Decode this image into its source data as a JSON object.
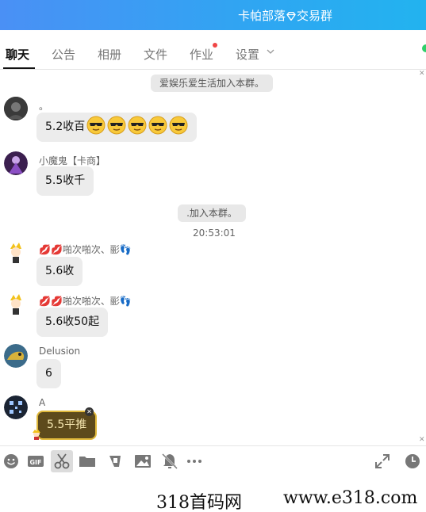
{
  "window": {
    "title_prefix": "卡帕部落",
    "title_suffix": "交易群"
  },
  "tabs": [
    {
      "label": "聊天",
      "active": true
    },
    {
      "label": "公告"
    },
    {
      "label": "相册"
    },
    {
      "label": "文件"
    },
    {
      "label": "作业",
      "has_notification": true
    },
    {
      "label": "设置",
      "has_dropdown": true
    }
  ],
  "messages": [
    {
      "type": "system",
      "text": "爱娱乐爱生活加入本群。"
    },
    {
      "type": "chat",
      "sender": "。",
      "text": "5.2收百",
      "emoji": "sunglasses-emoji",
      "emoji_count": 5
    },
    {
      "type": "chat",
      "sender": "小魔鬼【卡商】",
      "text": "5.5收千"
    },
    {
      "type": "system",
      "text": ".加入本群。"
    },
    {
      "type": "time",
      "text": "20:53:01"
    },
    {
      "type": "chat",
      "sender": "啪次啪次、彨",
      "text": "5.6收"
    },
    {
      "type": "chat",
      "sender": "啪次啪次、彨",
      "text": "5.6收50起"
    },
    {
      "type": "chat",
      "sender": "Delusion",
      "text": "6"
    },
    {
      "type": "chat",
      "sender": "A",
      "text": "5.5平推",
      "style": "gold"
    }
  ],
  "toolbar": {
    "icons": [
      "smiley-icon",
      "gif-icon",
      "scissors-icon",
      "folder-icon",
      "music-icon",
      "image-icon",
      "mute-bell-icon",
      "more-icon",
      "expand-icon",
      "clock-icon"
    ],
    "active_icon": "scissors-icon"
  },
  "watermark": {
    "left": "318首码网",
    "right": "www.e318.com"
  },
  "colors": {
    "titlebar": "#3a9cf4",
    "unread_dot": "#f04646",
    "online_dot": "#2fcf6a",
    "gold_bubble_border": "#e0b93c"
  }
}
